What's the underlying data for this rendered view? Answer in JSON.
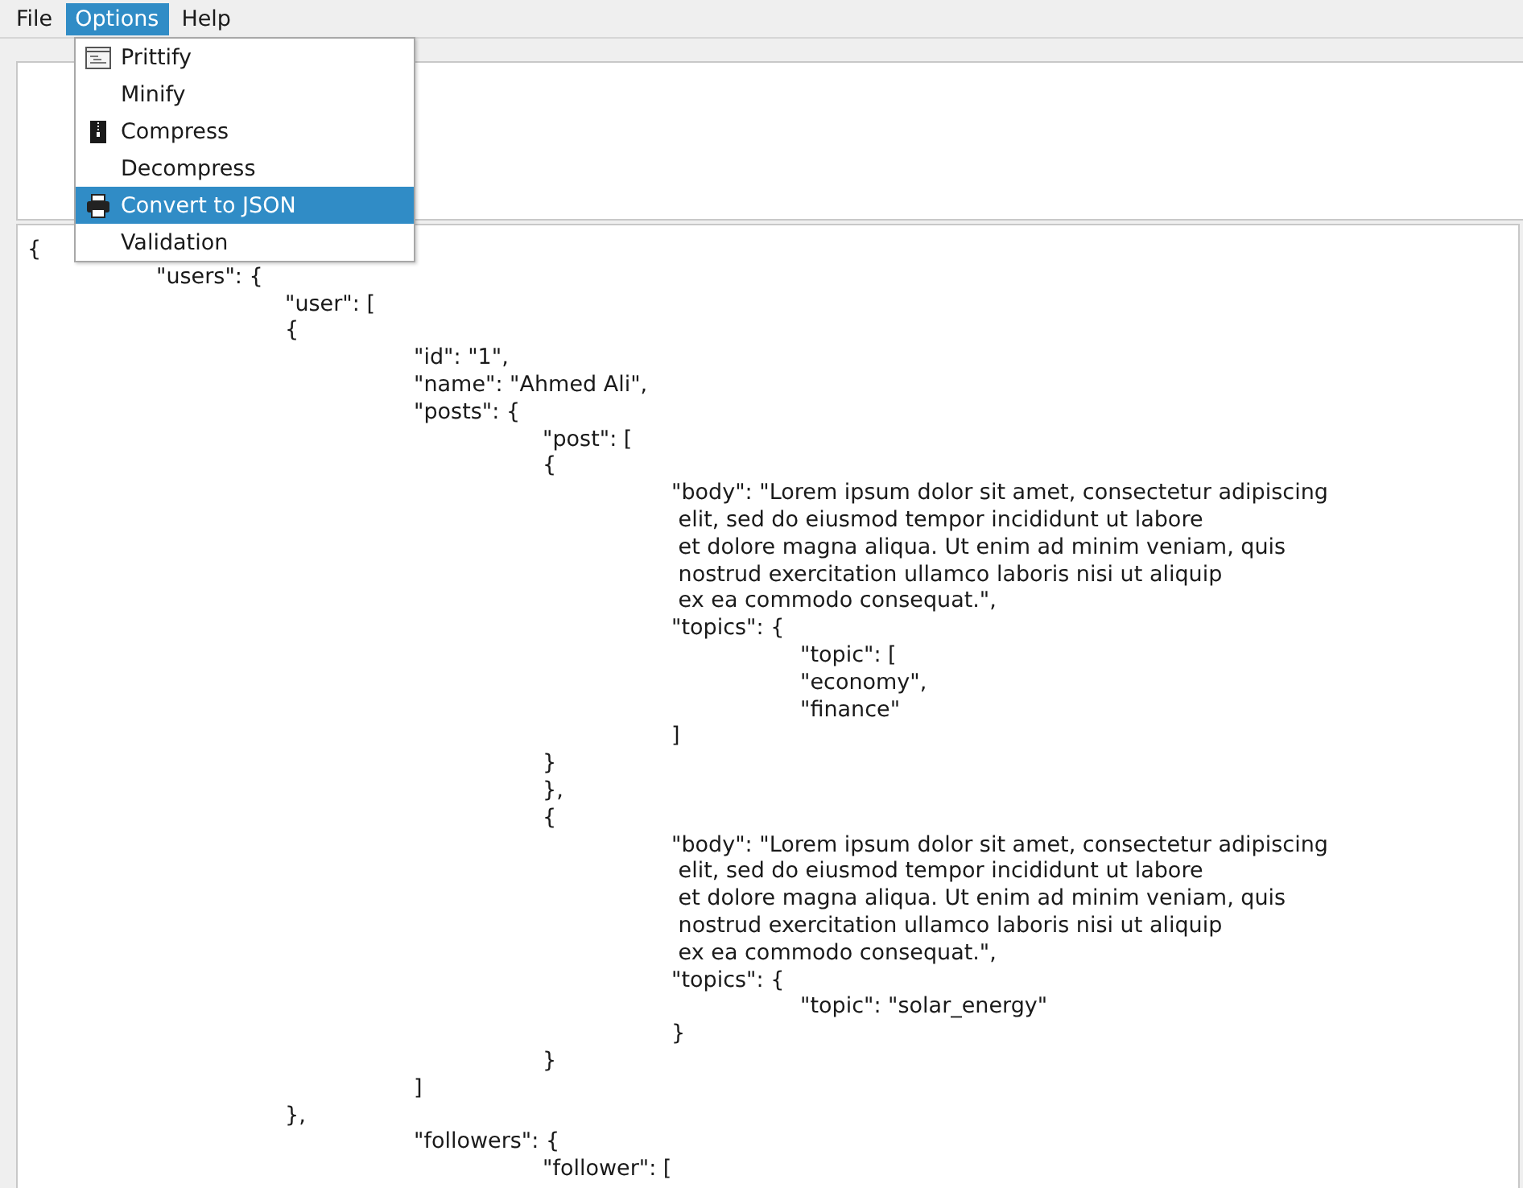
{
  "menu_bar": [
    {
      "label": "File",
      "selected": false
    },
    {
      "label": "Options",
      "selected": true
    },
    {
      "label": "Help",
      "selected": false
    }
  ],
  "options_menu": [
    {
      "label": "Prittify",
      "kind": "prettify",
      "selected": false
    },
    {
      "label": "Minify",
      "kind": "plain",
      "selected": false
    },
    {
      "label": "Compress",
      "kind": "compress",
      "selected": false
    },
    {
      "label": "Decompress",
      "kind": "plain",
      "selected": false
    },
    {
      "label": "Convert to JSON",
      "kind": "convert",
      "selected": true
    },
    {
      "label": "Validation",
      "kind": "plain",
      "selected": false
    }
  ],
  "output": [
    {
      "text": "{",
      "children": [
        {
          "text": "\"users\": {",
          "children": [
            {
              "text": "\"user\": ["
            },
            {
              "text": "{",
              "children": [
                {
                  "text": "\"id\": \"1\","
                },
                {
                  "text": "\"name\": \"Ahmed Ali\","
                },
                {
                  "text": "\"posts\": {",
                  "children": [
                    {
                      "text": "\"post\": ["
                    },
                    {
                      "text": "{",
                      "children": [
                        {
                          "text": "\"body\": \"Lorem ipsum dolor sit amet, consectetur adipiscing"
                        },
                        {
                          "text": " elit, sed do eiusmod tempor incididunt ut labore"
                        },
                        {
                          "text": " et dolore magna aliqua. Ut enim ad minim veniam, quis"
                        },
                        {
                          "text": " nostrud exercitation ullamco laboris nisi ut aliquip"
                        },
                        {
                          "text": " ex ea commodo consequat.\","
                        },
                        {
                          "text": "\"topics\": {",
                          "children": [
                            {
                              "text": "\"topic\": ["
                            },
                            {
                              "text": "\"economy\","
                            },
                            {
                              "text": "\"finance\""
                            }
                          ]
                        },
                        {
                          "text": "]"
                        }
                      ]
                    },
                    {
                      "text": "}"
                    },
                    {
                      "text": "},"
                    },
                    {
                      "text": "{",
                      "children": [
                        {
                          "text": "\"body\": \"Lorem ipsum dolor sit amet, consectetur adipiscing"
                        },
                        {
                          "text": " elit, sed do eiusmod tempor incididunt ut labore"
                        },
                        {
                          "text": " et dolore magna aliqua. Ut enim ad minim veniam, quis"
                        },
                        {
                          "text": " nostrud exercitation ullamco laboris nisi ut aliquip"
                        },
                        {
                          "text": " ex ea commodo consequat.\","
                        },
                        {
                          "text": "\"topics\": {",
                          "children": [
                            {
                              "text": "\"topic\": \"solar_energy\""
                            }
                          ]
                        },
                        {
                          "text": "}"
                        }
                      ]
                    },
                    {
                      "text": "}"
                    }
                  ]
                },
                {
                  "text": "]"
                }
              ]
            },
            {
              "text": "},",
              "children": [
                {
                  "text": "\"followers\": {",
                  "children": [
                    {
                      "text": "\"follower\": ["
                    }
                  ]
                }
              ]
            }
          ]
        }
      ]
    }
  ]
}
